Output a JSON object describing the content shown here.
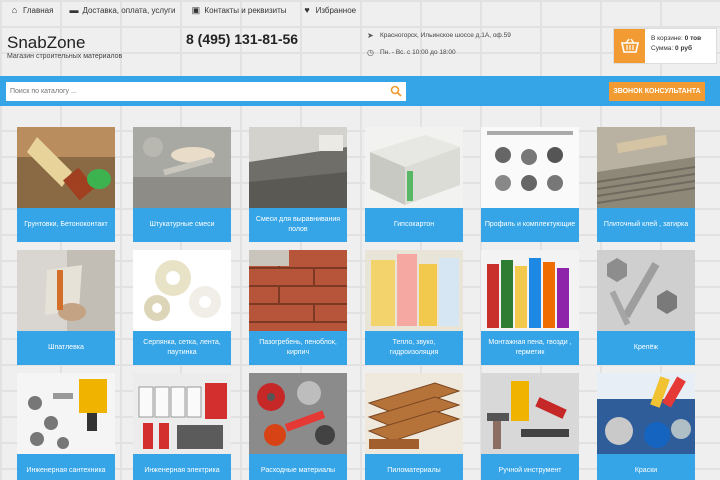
{
  "topnav": [
    {
      "label": "Главная",
      "icon": "home-icon"
    },
    {
      "label": "Доставка, оплата, услуги",
      "icon": "truck-icon"
    },
    {
      "label": "Контакты и реквизиты",
      "icon": "contacts-icon"
    },
    {
      "label": "Избранное",
      "icon": "heart-icon"
    }
  ],
  "header": {
    "logo_name": "SnabZone",
    "logo_tagline": "Магазин строительных материалов",
    "phone": "8 (495) 131-81-56",
    "address": "Красногорск, Ильинское шоссе д.1А, оф.59",
    "hours": "Пн. - Вс. с 10:00 до 18:00",
    "cart_line1_label": "В корзине:",
    "cart_line1_value": "0 тов",
    "cart_line2_label": "Сумма:",
    "cart_line2_value": "0 руб"
  },
  "search": {
    "placeholder": "Поиск по каталогу ...",
    "consult_label": "ЗВОНОК КОНСУЛЬТАНТА"
  },
  "categories": [
    {
      "label": "Грунтовки, Бетоноконтакт"
    },
    {
      "label": "Штукатурные смеси"
    },
    {
      "label": "Смеси для выравнивания полов"
    },
    {
      "label": "Гипсокартон"
    },
    {
      "label": "Профиль и комплектующие"
    },
    {
      "label": "Плиточный клей , затирка"
    },
    {
      "label": "Шпатлевка"
    },
    {
      "label": "Серпянка, сетка, лента, паутинка"
    },
    {
      "label": "Пазогребень, пеноблок, кирпич"
    },
    {
      "label": "Тепло, звуко, гидроизоляция"
    },
    {
      "label": "Монтажная пена, гвозди , герметик"
    },
    {
      "label": "Крепёж"
    },
    {
      "label": "Инженерная сантехника"
    },
    {
      "label": "Инженерная электрика"
    },
    {
      "label": "Расходные материалы"
    },
    {
      "label": "Пиломатериалы"
    },
    {
      "label": "Ручной инструмент"
    },
    {
      "label": "Краски"
    }
  ],
  "colors": {
    "accent_blue": "#35a5e7",
    "accent_orange": "#f19b32"
  }
}
